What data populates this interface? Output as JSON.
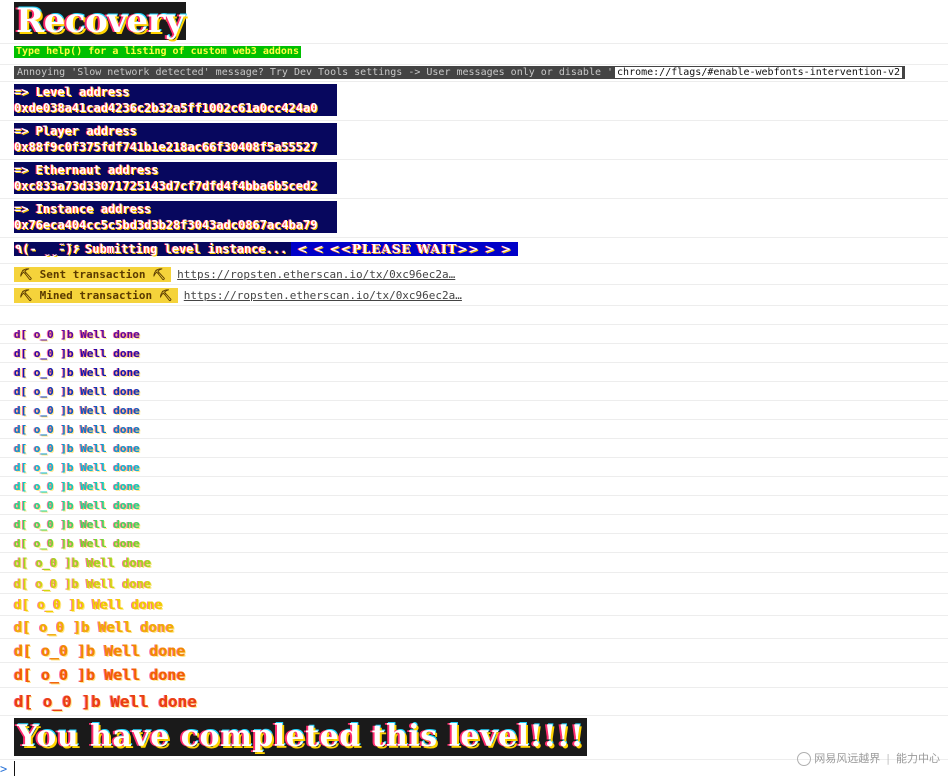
{
  "console": {
    "title": "Recovery",
    "help": "Type help() for a listing of custom web3 addons",
    "annoying": "Annoying 'Slow network detected' message? Try Dev Tools settings -> User messages only or disable '",
    "annoying_flag": "chrome://flags/#enable-webfonts-intervention-v2",
    "addresses": [
      {
        "label": "=> Level address",
        "value": "0xde038a41cad4236c2b32a5ff1002c61a0cc424a0"
      },
      {
        "label": "=> Player address",
        "value": "0x88f9c0f375fdf741b1e218ac66f30408f5a55527"
      },
      {
        "label": "=> Ethernaut address",
        "value": "0xc833a73d33071725143d7cf7dfd4f4bba6b5ced2"
      },
      {
        "label": "=> Instance address",
        "value": "0x76eca404cc5c5bd3d3b28f3043adc0867ac4ba79"
      }
    ],
    "submitting": {
      "face": "٩(- ̮̮̃-̃)۶",
      "text": "Submitting level instance...",
      "wait": "< < <<PLEASE WAIT>> > >"
    },
    "transactions": [
      {
        "badge": "⛏ Sent transaction ⛏",
        "link": "https://ropsten.etherscan.io/tx/0xc96ec2a…"
      },
      {
        "badge": "⛏ Mined transaction ⛏",
        "link": "https://ropsten.etherscan.io/tx/0xc96ec2a…"
      }
    ],
    "well_done_text": "d[ o_0 ]b Well done",
    "well_done": [
      {
        "color": "#5a0a9e",
        "text": "d[ o_0 ]b Well done"
      },
      {
        "color": "#2a0aa8",
        "text": "d[ o_0 ]b Well done"
      },
      {
        "color": "#0a1ab0",
        "text": "d[ o_0 ]b Well done"
      },
      {
        "color": "#0a3ab8",
        "text": "d[ o_0 ]b Well done"
      },
      {
        "color": "#0a5ac0",
        "text": "d[ o_0 ]b Well done"
      },
      {
        "color": "#0a7ac8",
        "text": "d[ o_0 ]b Well done"
      },
      {
        "color": "#0a9ad0",
        "text": "d[ o_0 ]b Well done"
      },
      {
        "color": "#0ab8d8",
        "text": "d[ o_0 ]b Well done"
      },
      {
        "color": "#0ad0c0",
        "text": "d[ o_0 ]b Well done"
      },
      {
        "color": "#20d890",
        "text": "d[ o_0 ]b Well done"
      },
      {
        "color": "#40d860",
        "text": "d[ o_0 ]b Well done"
      },
      {
        "color": "#70d830",
        "text": "d[ o_0 ]b Well done"
      },
      {
        "color": "#a0d820",
        "text": "d[ o_0 ]b Well done"
      },
      {
        "color": "#d0d810",
        "text": "d[ o_0 ]b Well done"
      },
      {
        "color": "#f0d000",
        "text": "d[ o_0 ]b Well done"
      },
      {
        "color": "#f0b000",
        "text": "d[ o_0 ]b Well done"
      },
      {
        "color": "#f08a00",
        "text": "d[ o_0 ]b Well done"
      },
      {
        "color": "#f06000",
        "text": "d[ o_0 ]b Well done"
      },
      {
        "color": "#e84010",
        "text": "d[ o_0 ]b Well done"
      }
    ],
    "complete": "You have completed this level!!!!",
    "prompt_symbol": ">"
  },
  "watermark": {
    "left": "网易风远越界",
    "right": "能力中心"
  },
  "icons": {
    "watermark_logo": "circle-logo-icon",
    "prompt": "chevron-right-icon"
  }
}
